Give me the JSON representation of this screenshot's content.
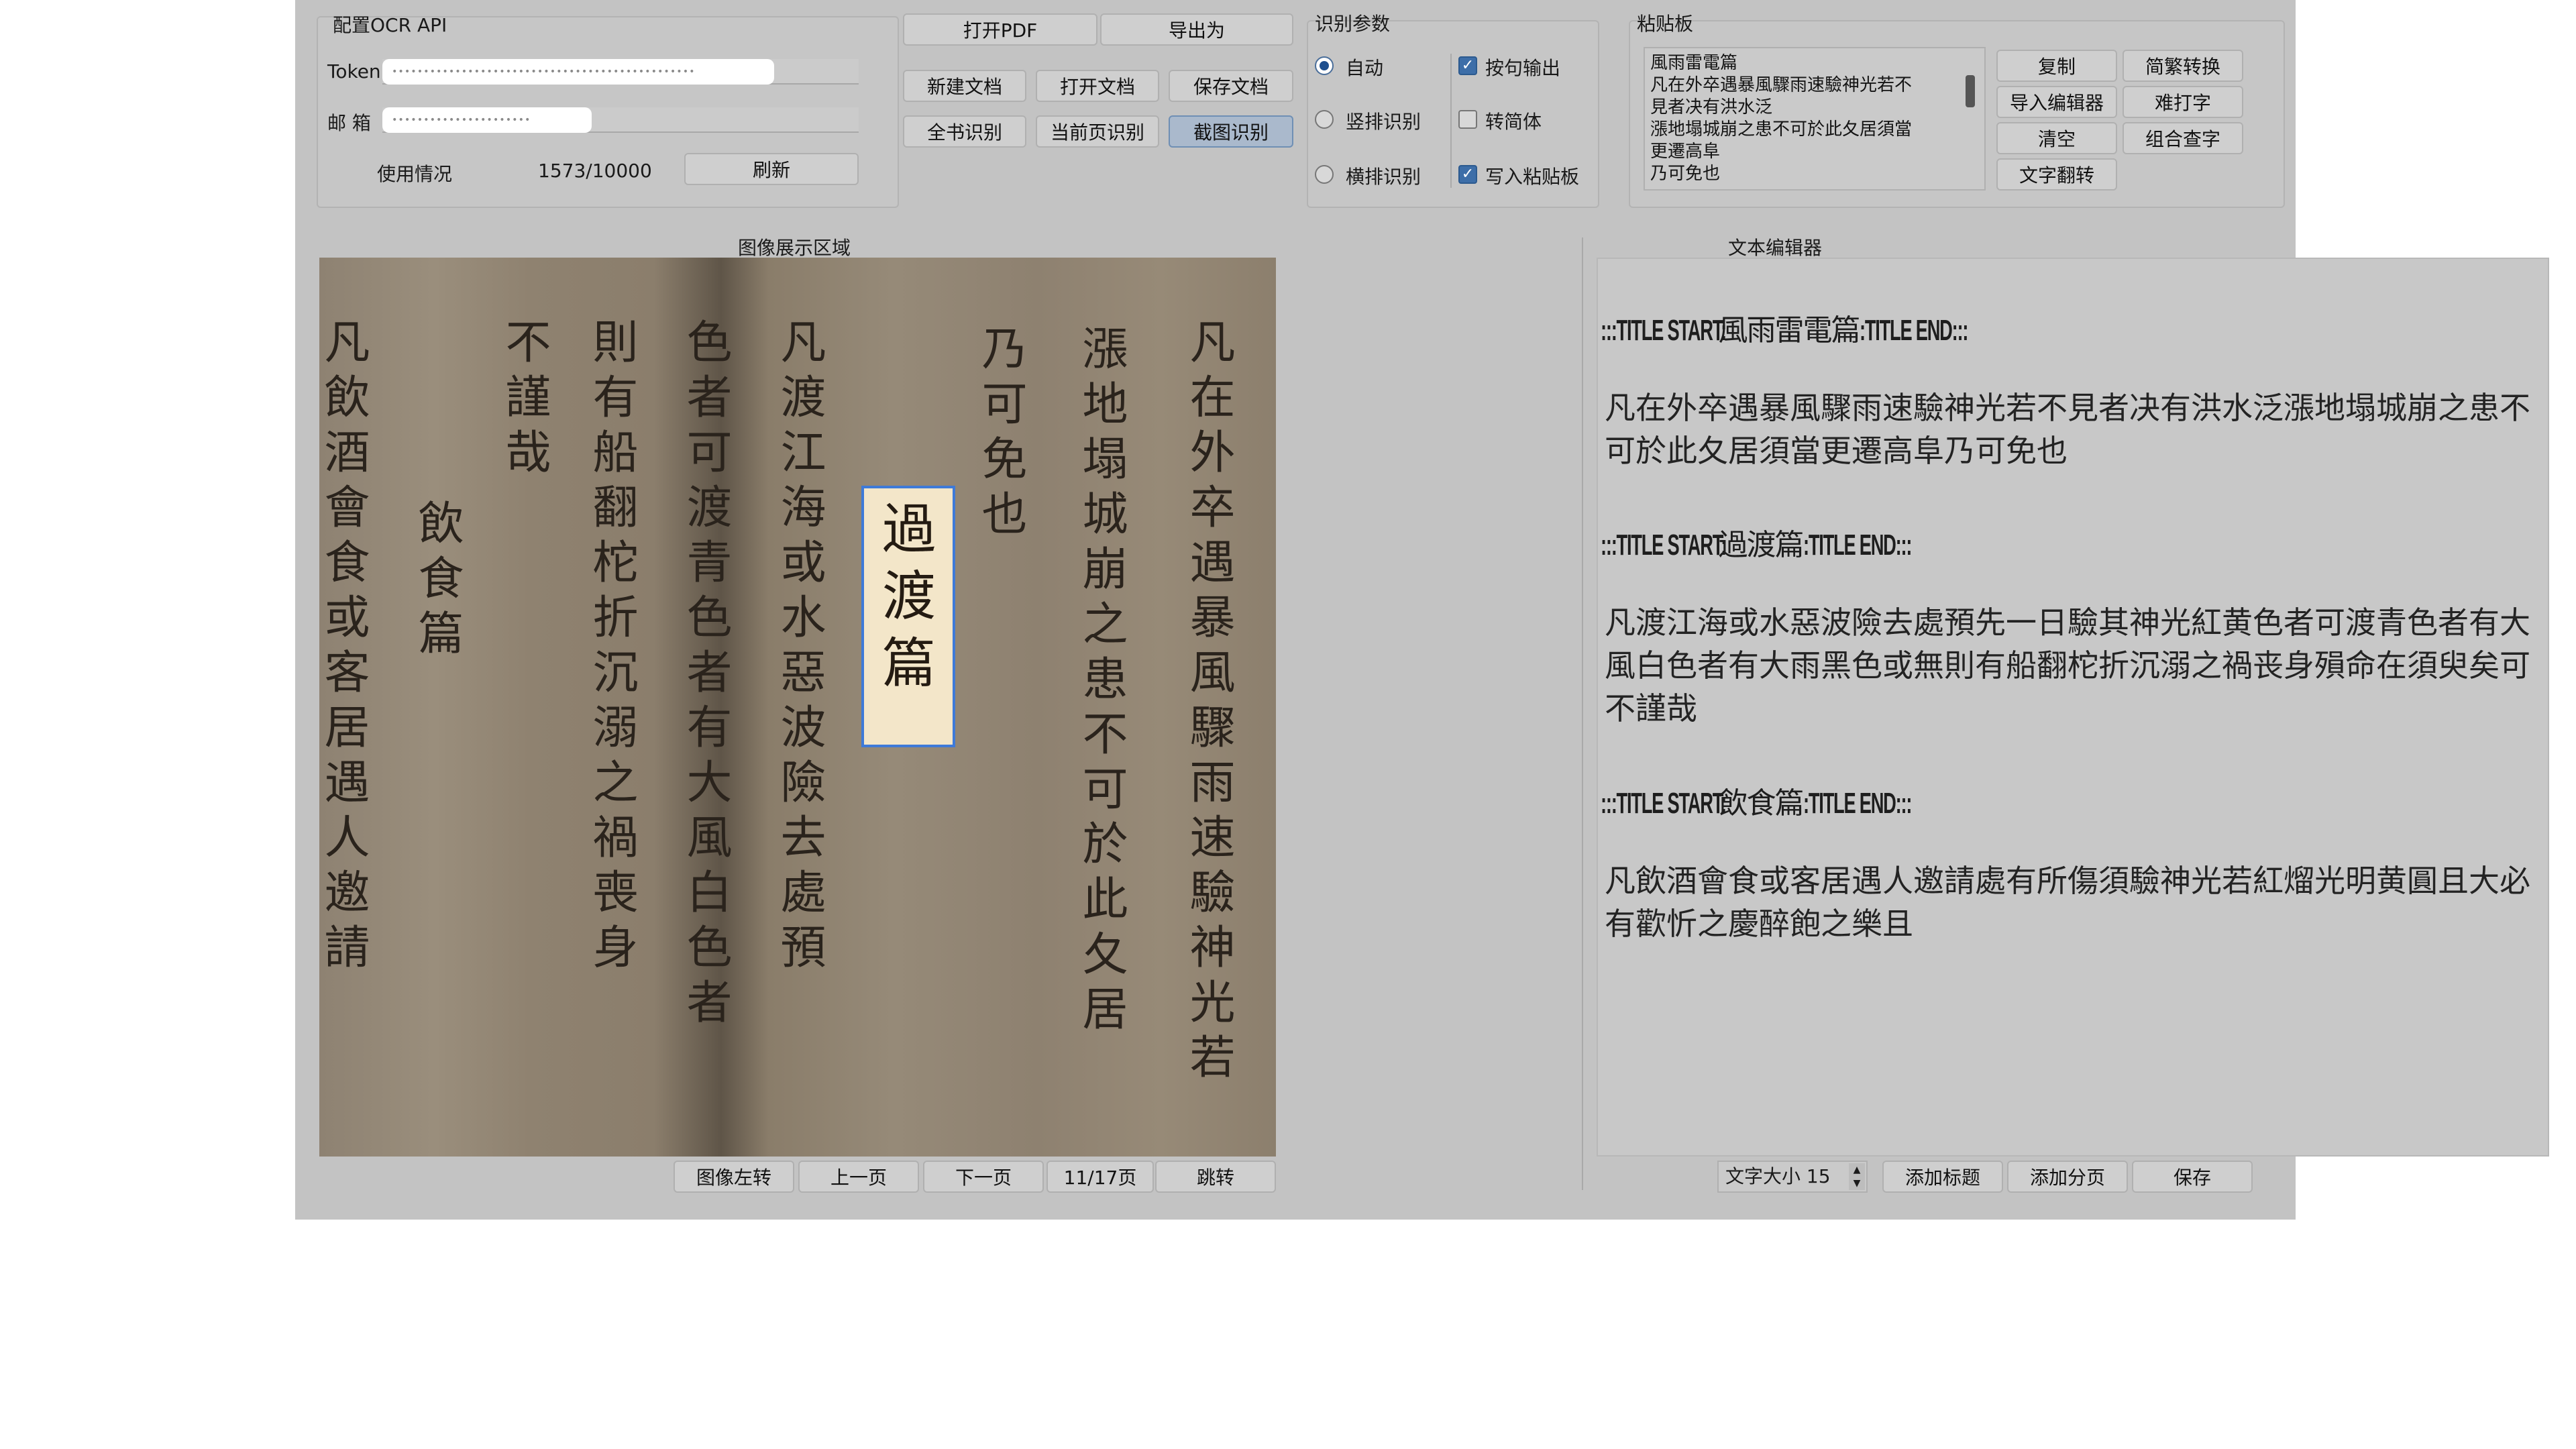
{
  "ocr_api": {
    "title": "配置OCR API",
    "token_label": "Token",
    "token_value": "••••••••••••••••••••••••••••••••••••••••••••••••",
    "email_label": "邮 箱",
    "email_value": "••••••••••••••••••••••",
    "usage_label": "使用情况",
    "usage_value": "1573/10000",
    "refresh_label": "刷新"
  },
  "toolbar": {
    "open_pdf": "打开PDF",
    "export_as": "导出为",
    "new_doc": "新建文档",
    "open_doc": "打开文档",
    "save_doc": "保存文档",
    "full_book": "全书识别",
    "current_page": "当前页识别",
    "screenshot": "截图识别"
  },
  "recog": {
    "title": "识别参数",
    "auto": "自动",
    "vertical": "竖排识别",
    "horizontal": "横排识别",
    "sentence_output": "按句输出",
    "to_simplified": "转简体",
    "write_clipboard": "写入粘贴板",
    "selected_mode": "auto",
    "sentence_output_checked": true,
    "to_simplified_checked": false,
    "write_clipboard_checked": true
  },
  "clipboard": {
    "title": "粘贴板",
    "lines": [
      "風雨雷電篇",
      "凡在外卒遇暴風驟雨速驗神光若不",
      "見者决有洪水泛",
      "漲地塌城崩之患不可於此夂居須當",
      "更遷高阜",
      "乃可免也"
    ],
    "copy": "复制",
    "trad_simp": "简繁转换",
    "import_editor": "导入编辑器",
    "hard_char": "难打字",
    "clear": "清空",
    "combine_lookup": "组合查字",
    "text_flip": "文字翻转"
  },
  "image_panel": {
    "title": "图像展示区域",
    "columns": [
      "凡在外卒遇暴風驟雨速驗神光若",
      "漲地塌城崩之患不可於此夂居",
      "乃可免也",
      "凡渡江海或水惡波險去處預",
      "色者可渡青色者有大風白色者",
      "則有船翻柁折沉溺之禍喪身",
      "不謹哉",
      "飲食篇",
      "凡飲酒會食或客居遇人邀請"
    ],
    "selection_text": "過渡篇",
    "rotate_left": "图像左转",
    "prev_page": "上一页",
    "next_page": "下一页",
    "page_indicator": "11/17页",
    "jump": "跳转"
  },
  "editor": {
    "title": "文本编辑器",
    "sections": [
      {
        "title_prefix": ":::TITLE START:",
        "title": "風雨雷電篇",
        "title_suffix": ":TITLE END:::",
        "body": "凡在外卒遇暴風驟雨速驗神光若不見者决有洪水泛漲地塌城崩之患不可於此夂居須當更遷高阜乃可免也"
      },
      {
        "title_prefix": ":::TITLE START:",
        "title": "過渡篇",
        "title_suffix": ":TITLE END:::",
        "body": "凡渡江海或水惡波險去處預先一日驗其神光紅黄色者可渡青色者有大風白色者有大雨黑色或無則有船翻柁折沉溺之禍丧身殞命在須臾矣可不謹哉"
      },
      {
        "title_prefix": ":::TITLE START:",
        "title": "飲食篇",
        "title_suffix": ":TITLE END:::",
        "body": "凡飲酒會食或客居遇人邀請處有所傷須驗神光若紅熘光明黄圓且大必有歡忻之慶醉飽之樂且"
      }
    ],
    "font_size_label": "文字大小",
    "font_size_value": "15",
    "add_title": "添加标题",
    "add_page_break": "添加分页",
    "save": "保存"
  }
}
